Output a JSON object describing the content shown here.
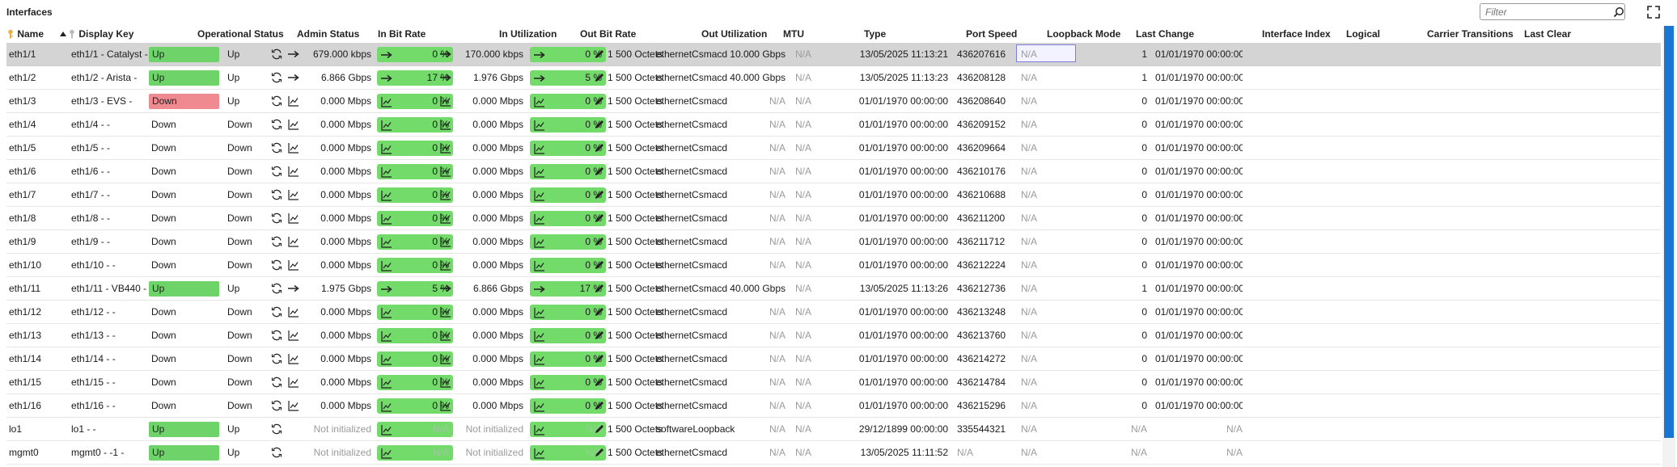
{
  "panel": {
    "title": "Interfaces"
  },
  "filter": {
    "placeholder": "Filter",
    "value": ""
  },
  "columns": {
    "name": "Name",
    "display_key": "Display Key",
    "oper_status": "Operational Status",
    "admin_status": "Admin Status",
    "in_bit_rate": "In Bit Rate",
    "in_util": "In Utilization",
    "out_bit_rate": "Out Bit Rate",
    "out_util": "Out Utilization",
    "mtu": "MTU",
    "type": "Type",
    "port_speed": "Port Speed",
    "loopback": "Loopback Mode",
    "last_change": "Last Change",
    "if_index": "Interface Index",
    "logical": "Logical",
    "carrier": "Carrier Transitions",
    "last_clear": "Last Clear"
  },
  "colors": {
    "up": "#6ed46a",
    "down": "#f08a91",
    "util": "#72db6a",
    "selected": "#d4d4d4",
    "scroll": "#1976d2"
  },
  "rows": [
    {
      "name": "eth1/1",
      "key": "eth1/1 - Catalyst -",
      "oper": "Up",
      "admin": "Up",
      "in_icon": "arrow",
      "in_rate": "679.000 kbps",
      "in_util": "0 %",
      "out_icon": "arrow",
      "out_rate": "170.000 kbps",
      "out_util": "0 %",
      "mtu": "1 500 Octets",
      "type": "ethernetCsmacd",
      "speed": "10.000 Gbps",
      "loop": "N/A",
      "last_change": "13/05/2025 11:13:21",
      "ifindex": "436207616",
      "logical": "N/A",
      "carrier": "1",
      "last_clear": "01/01/1970 00:00:00"
    },
    {
      "name": "eth1/2",
      "key": "eth1/2 - Arista -",
      "oper": "Up",
      "admin": "Up",
      "in_icon": "arrow",
      "in_rate": "6.866 Gbps",
      "in_util": "17 %",
      "out_icon": "arrow",
      "out_rate": "1.976 Gbps",
      "out_util": "5 %",
      "mtu": "1 500 Octets",
      "type": "ethernetCsmacd",
      "speed": "40.000 Gbps",
      "loop": "N/A",
      "last_change": "13/05/2025 11:13:23",
      "ifindex": "436208128",
      "logical": "N/A",
      "carrier": "1",
      "last_clear": "01/01/1970 00:00:00"
    },
    {
      "name": "eth1/3",
      "key": "eth1/3 - EVS -",
      "oper": "Down",
      "admin": "Up",
      "in_icon": "chart",
      "in_rate": "0.000 Mbps",
      "in_util": "0 %",
      "out_icon": "chart",
      "out_rate": "0.000 Mbps",
      "out_util": "0 %",
      "mtu": "1 500 Octets",
      "type": "ethernetCsmacd",
      "speed": "N/A",
      "loop": "N/A",
      "last_change": "01/01/1970 00:00:00",
      "ifindex": "436208640",
      "logical": "N/A",
      "carrier": "0",
      "last_clear": "01/01/1970 00:00:00"
    },
    {
      "name": "eth1/4",
      "key": "eth1/4 -  -",
      "oper": "Down",
      "admin": "Down",
      "in_icon": "chart",
      "in_rate": "0.000 Mbps",
      "in_util": "0 %",
      "out_icon": "chart",
      "out_rate": "0.000 Mbps",
      "out_util": "0 %",
      "mtu": "1 500 Octets",
      "type": "ethernetCsmacd",
      "speed": "N/A",
      "loop": "N/A",
      "last_change": "01/01/1970 00:00:00",
      "ifindex": "436209152",
      "logical": "N/A",
      "carrier": "0",
      "last_clear": "01/01/1970 00:00:00"
    },
    {
      "name": "eth1/5",
      "key": "eth1/5 -  -",
      "oper": "Down",
      "admin": "Down",
      "in_icon": "chart",
      "in_rate": "0.000 Mbps",
      "in_util": "0 %",
      "out_icon": "chart",
      "out_rate": "0.000 Mbps",
      "out_util": "0 %",
      "mtu": "1 500 Octets",
      "type": "ethernetCsmacd",
      "speed": "N/A",
      "loop": "N/A",
      "last_change": "01/01/1970 00:00:00",
      "ifindex": "436209664",
      "logical": "N/A",
      "carrier": "0",
      "last_clear": "01/01/1970 00:00:00"
    },
    {
      "name": "eth1/6",
      "key": "eth1/6 -  -",
      "oper": "Down",
      "admin": "Down",
      "in_icon": "chart",
      "in_rate": "0.000 Mbps",
      "in_util": "0 %",
      "out_icon": "chart",
      "out_rate": "0.000 Mbps",
      "out_util": "0 %",
      "mtu": "1 500 Octets",
      "type": "ethernetCsmacd",
      "speed": "N/A",
      "loop": "N/A",
      "last_change": "01/01/1970 00:00:00",
      "ifindex": "436210176",
      "logical": "N/A",
      "carrier": "0",
      "last_clear": "01/01/1970 00:00:00"
    },
    {
      "name": "eth1/7",
      "key": "eth1/7 -  -",
      "oper": "Down",
      "admin": "Down",
      "in_icon": "chart",
      "in_rate": "0.000 Mbps",
      "in_util": "0 %",
      "out_icon": "chart",
      "out_rate": "0.000 Mbps",
      "out_util": "0 %",
      "mtu": "1 500 Octets",
      "type": "ethernetCsmacd",
      "speed": "N/A",
      "loop": "N/A",
      "last_change": "01/01/1970 00:00:00",
      "ifindex": "436210688",
      "logical": "N/A",
      "carrier": "0",
      "last_clear": "01/01/1970 00:00:00"
    },
    {
      "name": "eth1/8",
      "key": "eth1/8 -  -",
      "oper": "Down",
      "admin": "Down",
      "in_icon": "chart",
      "in_rate": "0.000 Mbps",
      "in_util": "0 %",
      "out_icon": "chart",
      "out_rate": "0.000 Mbps",
      "out_util": "0 %",
      "mtu": "1 500 Octets",
      "type": "ethernetCsmacd",
      "speed": "N/A",
      "loop": "N/A",
      "last_change": "01/01/1970 00:00:00",
      "ifindex": "436211200",
      "logical": "N/A",
      "carrier": "0",
      "last_clear": "01/01/1970 00:00:00"
    },
    {
      "name": "eth1/9",
      "key": "eth1/9 -  -",
      "oper": "Down",
      "admin": "Down",
      "in_icon": "chart",
      "in_rate": "0.000 Mbps",
      "in_util": "0 %",
      "out_icon": "chart",
      "out_rate": "0.000 Mbps",
      "out_util": "0 %",
      "mtu": "1 500 Octets",
      "type": "ethernetCsmacd",
      "speed": "N/A",
      "loop": "N/A",
      "last_change": "01/01/1970 00:00:00",
      "ifindex": "436211712",
      "logical": "N/A",
      "carrier": "0",
      "last_clear": "01/01/1970 00:00:00"
    },
    {
      "name": "eth1/10",
      "key": "eth1/10 -  -",
      "oper": "Down",
      "admin": "Down",
      "in_icon": "chart",
      "in_rate": "0.000 Mbps",
      "in_util": "0 %",
      "out_icon": "chart",
      "out_rate": "0.000 Mbps",
      "out_util": "0 %",
      "mtu": "1 500 Octets",
      "type": "ethernetCsmacd",
      "speed": "N/A",
      "loop": "N/A",
      "last_change": "01/01/1970 00:00:00",
      "ifindex": "436212224",
      "logical": "N/A",
      "carrier": "0",
      "last_clear": "01/01/1970 00:00:00"
    },
    {
      "name": "eth1/11",
      "key": "eth1/11 - VB440 -",
      "oper": "Up",
      "admin": "Up",
      "in_icon": "arrow",
      "in_rate": "1.975 Gbps",
      "in_util": "5 %",
      "out_icon": "arrow",
      "out_rate": "6.866 Gbps",
      "out_util": "17 %",
      "mtu": "1 500 Octets",
      "type": "ethernetCsmacd",
      "speed": "40.000 Gbps",
      "loop": "N/A",
      "last_change": "13/05/2025 11:13:26",
      "ifindex": "436212736",
      "logical": "N/A",
      "carrier": "1",
      "last_clear": "01/01/1970 00:00:00"
    },
    {
      "name": "eth1/12",
      "key": "eth1/12 -  -",
      "oper": "Down",
      "admin": "Down",
      "in_icon": "chart",
      "in_rate": "0.000 Mbps",
      "in_util": "0 %",
      "out_icon": "chart",
      "out_rate": "0.000 Mbps",
      "out_util": "0 %",
      "mtu": "1 500 Octets",
      "type": "ethernetCsmacd",
      "speed": "N/A",
      "loop": "N/A",
      "last_change": "01/01/1970 00:00:00",
      "ifindex": "436213248",
      "logical": "N/A",
      "carrier": "0",
      "last_clear": "01/01/1970 00:00:00"
    },
    {
      "name": "eth1/13",
      "key": "eth1/13 -  -",
      "oper": "Down",
      "admin": "Down",
      "in_icon": "chart",
      "in_rate": "0.000 Mbps",
      "in_util": "0 %",
      "out_icon": "chart",
      "out_rate": "0.000 Mbps",
      "out_util": "0 %",
      "mtu": "1 500 Octets",
      "type": "ethernetCsmacd",
      "speed": "N/A",
      "loop": "N/A",
      "last_change": "01/01/1970 00:00:00",
      "ifindex": "436213760",
      "logical": "N/A",
      "carrier": "0",
      "last_clear": "01/01/1970 00:00:00"
    },
    {
      "name": "eth1/14",
      "key": "eth1/14 -  -",
      "oper": "Down",
      "admin": "Down",
      "in_icon": "chart",
      "in_rate": "0.000 Mbps",
      "in_util": "0 %",
      "out_icon": "chart",
      "out_rate": "0.000 Mbps",
      "out_util": "0 %",
      "mtu": "1 500 Octets",
      "type": "ethernetCsmacd",
      "speed": "N/A",
      "loop": "N/A",
      "last_change": "01/01/1970 00:00:00",
      "ifindex": "436214272",
      "logical": "N/A",
      "carrier": "0",
      "last_clear": "01/01/1970 00:00:00"
    },
    {
      "name": "eth1/15",
      "key": "eth1/15 -  -",
      "oper": "Down",
      "admin": "Down",
      "in_icon": "chart",
      "in_rate": "0.000 Mbps",
      "in_util": "0 %",
      "out_icon": "chart",
      "out_rate": "0.000 Mbps",
      "out_util": "0 %",
      "mtu": "1 500 Octets",
      "type": "ethernetCsmacd",
      "speed": "N/A",
      "loop": "N/A",
      "last_change": "01/01/1970 00:00:00",
      "ifindex": "436214784",
      "logical": "N/A",
      "carrier": "0",
      "last_clear": "01/01/1970 00:00:00"
    },
    {
      "name": "eth1/16",
      "key": "eth1/16 -  -",
      "oper": "Down",
      "admin": "Down",
      "in_icon": "chart",
      "in_rate": "0.000 Mbps",
      "in_util": "0 %",
      "out_icon": "chart",
      "out_rate": "0.000 Mbps",
      "out_util": "0 %",
      "mtu": "1 500 Octets",
      "type": "ethernetCsmacd",
      "speed": "N/A",
      "loop": "N/A",
      "last_change": "01/01/1970 00:00:00",
      "ifindex": "436215296",
      "logical": "N/A",
      "carrier": "0",
      "last_clear": "01/01/1970 00:00:00"
    },
    {
      "name": "lo1",
      "key": "lo1 -  -",
      "oper": "Up",
      "admin": "Up",
      "in_icon": "none",
      "in_rate": "Not initialized",
      "in_util": "N/A",
      "out_icon": "none",
      "out_rate": "Not initialized",
      "out_util": "N/A",
      "mtu": "1 500 Octets",
      "type": "softwareLoopback",
      "speed": "N/A",
      "loop": "N/A",
      "last_change": "29/12/1899 00:00:00",
      "ifindex": "335544321",
      "logical": "N/A",
      "carrier": "N/A",
      "last_clear": "N/A"
    },
    {
      "name": "mgmt0",
      "key": "mgmt0 -  -1 -",
      "oper": "Up",
      "admin": "Up",
      "in_icon": "none",
      "in_rate": "Not initialized",
      "in_util": "N/A",
      "out_icon": "none",
      "out_rate": "Not initialized",
      "out_util": "N/A",
      "mtu": "1 500 Octets",
      "type": "ethernetCsmacd",
      "speed": "N/A",
      "loop": "N/A",
      "last_change": "13/05/2025 11:11:52",
      "ifindex": "N/A",
      "logical": "N/A",
      "carrier": "N/A",
      "last_clear": "N/A"
    }
  ]
}
